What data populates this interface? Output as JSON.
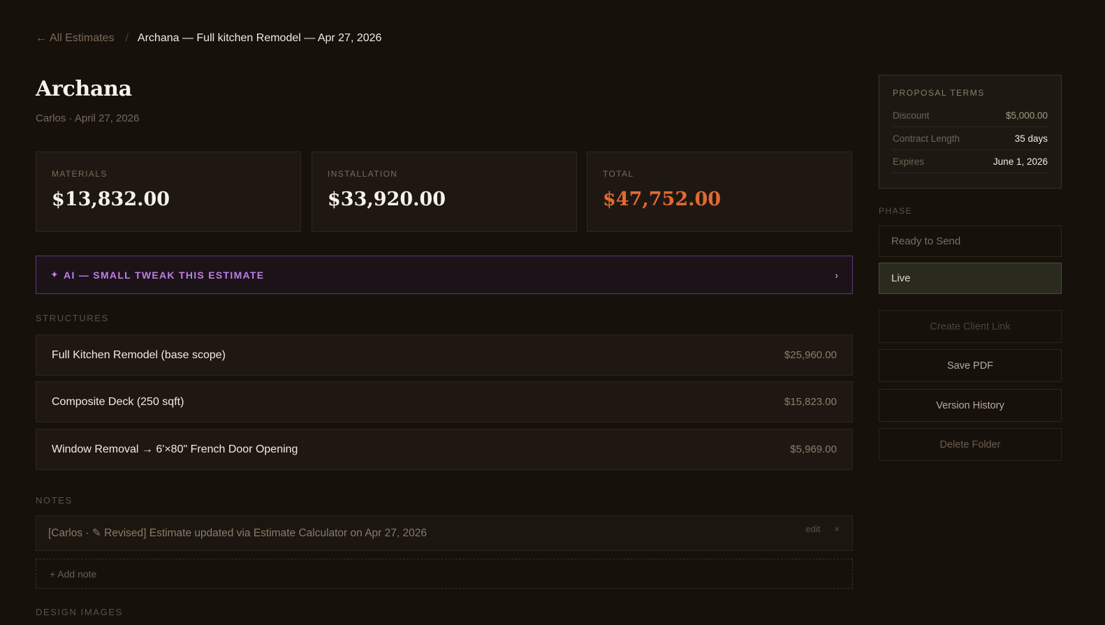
{
  "breadcrumb": {
    "back_icon": "←",
    "back_label": "All Estimates",
    "separator": "/",
    "current": "Archana — Full kitchen Remodel — Apr 27, 2026"
  },
  "header": {
    "title": "Archana",
    "subtitle": "Carlos · April 27, 2026"
  },
  "stats": {
    "materials": {
      "label": "MATERIALS",
      "value": "$13,832.00"
    },
    "installation": {
      "label": "INSTALLATION",
      "value": "$33,920.00"
    },
    "total": {
      "label": "TOTAL",
      "value": "$47,752.00"
    }
  },
  "ai_bar": {
    "icon": "✦",
    "label": "AI — SMALL TWEAK THIS ESTIMATE",
    "chevron": "›"
  },
  "structures": {
    "label": "STRUCTURES",
    "items": [
      {
        "name": "Full Kitchen Remodel (base scope)",
        "price": "$25,960.00"
      },
      {
        "name": "Composite Deck (250 sqft)",
        "price": "$15,823.00"
      },
      {
        "name": "Window Removal → 6'×80\" French Door Opening",
        "price": "$5,969.00"
      }
    ]
  },
  "notes": {
    "label": "NOTES",
    "items": [
      {
        "text": "[Carlos · ✎ Revised] Estimate updated via Estimate Calculator on Apr 27, 2026",
        "edit": "edit",
        "remove": "×"
      }
    ],
    "add_label": "+ Add note"
  },
  "design_images": {
    "label": "DESIGN IMAGES"
  },
  "terms": {
    "title": "PROPOSAL TERMS",
    "rows": [
      {
        "key": "Discount",
        "value": "$5,000.00"
      },
      {
        "key": "Contract Length",
        "value": "35 days"
      },
      {
        "key": "Expires",
        "value": "June 1, 2026"
      }
    ]
  },
  "phase": {
    "label": "PHASE",
    "options": [
      "Ready to Send",
      "Live"
    ],
    "selected": "Live"
  },
  "actions": {
    "create_link": "Create Client Link",
    "save_pdf": "Save PDF",
    "version_history": "Version History",
    "delete_folder": "Delete Folder"
  },
  "colors": {
    "background": "#17110c",
    "total_accent": "#e06a33",
    "ai_accent": "#c07ee6"
  }
}
